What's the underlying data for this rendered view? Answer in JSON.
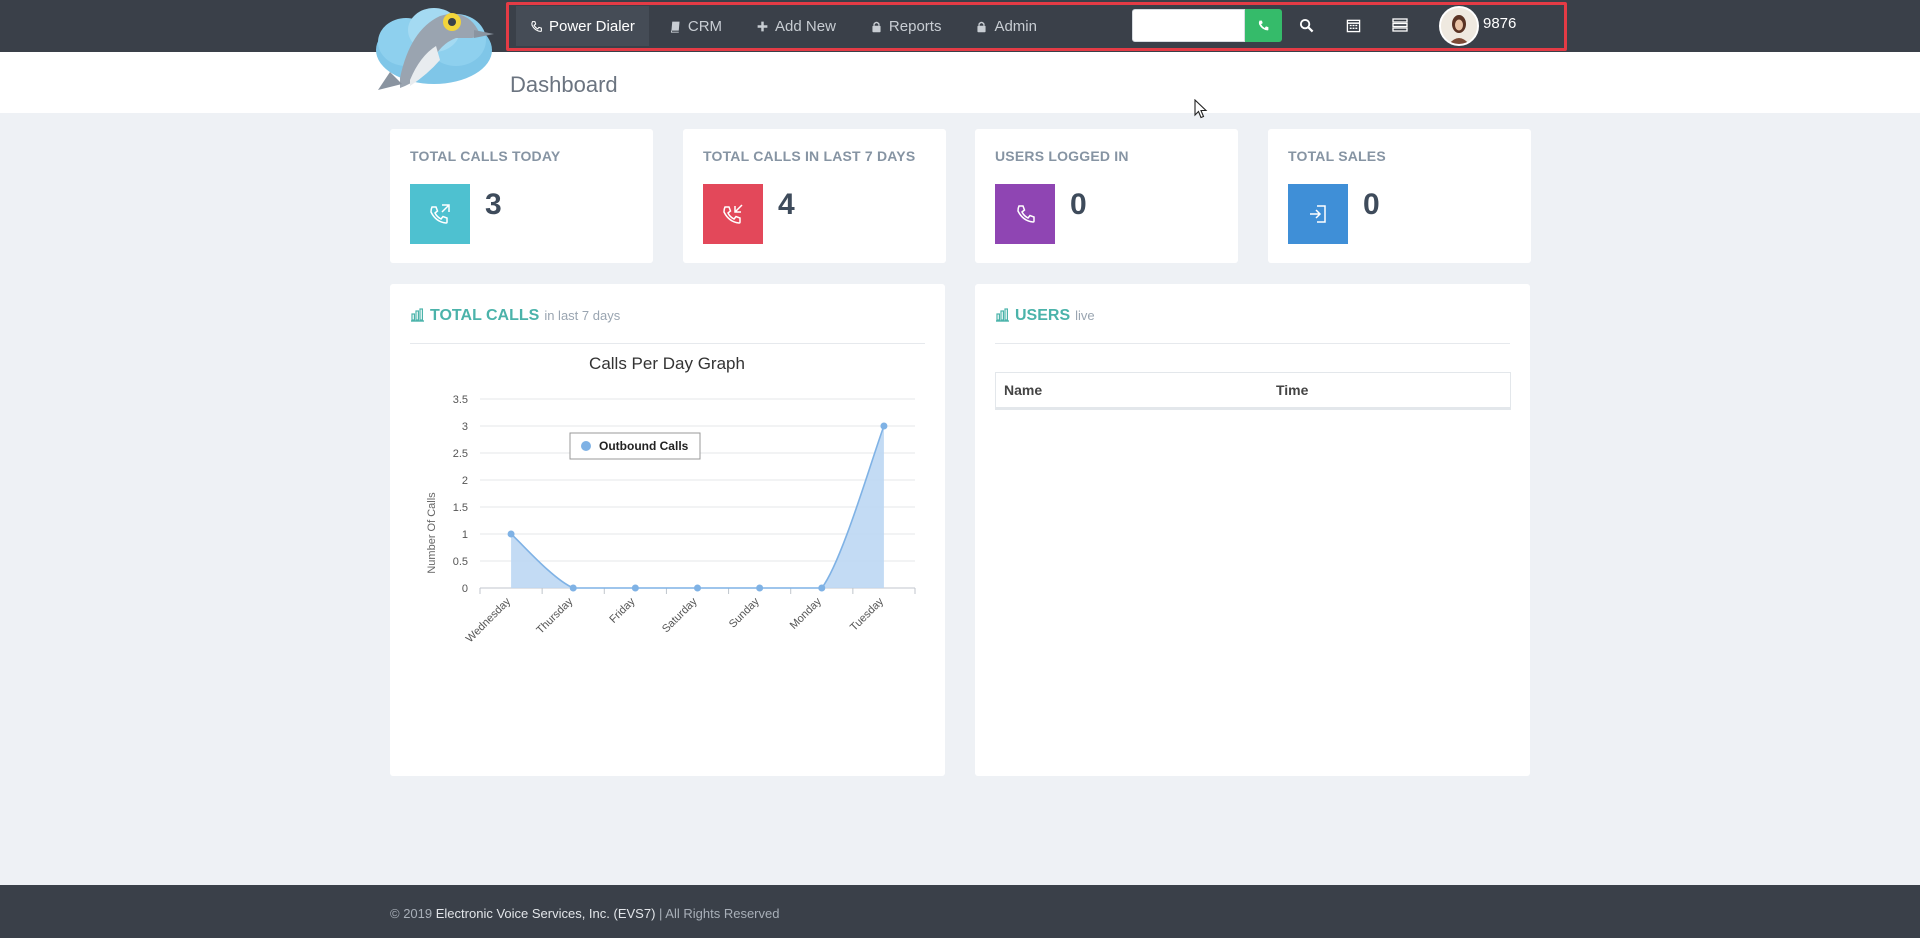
{
  "nav": {
    "items": [
      {
        "label": "Power Dialer",
        "icon": "phone-icon",
        "active": true
      },
      {
        "label": "CRM",
        "icon": "book-icon",
        "active": false
      },
      {
        "label": "Add New",
        "icon": "plus-icon",
        "active": false
      },
      {
        "label": "Reports",
        "icon": "lock-icon",
        "active": false
      },
      {
        "label": "Admin",
        "icon": "lock-icon",
        "active": false
      }
    ],
    "dial_input_value": "",
    "dial_button_icon": "phone-icon",
    "search_icon": "search-icon",
    "calendar_icon": "calendar-icon",
    "list_icon": "list-icon",
    "extension": "9876",
    "outline_color": "#e43b45"
  },
  "page": {
    "title": "Dashboard"
  },
  "stats": [
    {
      "label": "TOTAL CALLS TODAY",
      "value": "3",
      "color": "#4ec1d0",
      "icon": "outgoing-call-icon"
    },
    {
      "label": "TOTAL CALLS IN LAST 7 DAYS",
      "value": "4",
      "color": "#e3485a",
      "icon": "incoming-call-icon"
    },
    {
      "label": "USERS LOGGED IN",
      "value": "0",
      "color": "#8f45b3",
      "icon": "phone-icon"
    },
    {
      "label": "TOTAL SALES",
      "value": "0",
      "color": "#3f8fd7",
      "icon": "sign-in-icon"
    }
  ],
  "calls_panel": {
    "title": "TOTAL CALLS",
    "subtitle": "in last 7 days",
    "icon": "bar-chart-icon"
  },
  "users_panel": {
    "title": "USERS",
    "subtitle": "live",
    "icon": "bar-chart-icon",
    "columns": [
      "Name",
      "Time"
    ]
  },
  "chart_data": {
    "type": "area",
    "title": "Calls Per Day Graph",
    "xlabel": "",
    "ylabel": "Number Of Calls",
    "categories": [
      "Wednesday",
      "Thursday",
      "Friday",
      "Saturday",
      "Sunday",
      "Monday",
      "Tuesday"
    ],
    "series": [
      {
        "name": "Outbound Calls",
        "values": [
          1,
          0,
          0,
          0,
          0,
          0,
          3
        ],
        "color": "#7fb2e5"
      }
    ],
    "ylim": [
      0,
      3.5
    ],
    "yticks": [
      "0",
      "0.5",
      "1",
      "1.5",
      "2",
      "2.5",
      "3",
      "3.5"
    ],
    "grid": true,
    "legend": "top-left inside"
  },
  "footer": {
    "prefix": "© 2019",
    "company": "Electronic Voice Services, Inc. (EVS7)",
    "suffix": "| All Rights Reserved"
  }
}
